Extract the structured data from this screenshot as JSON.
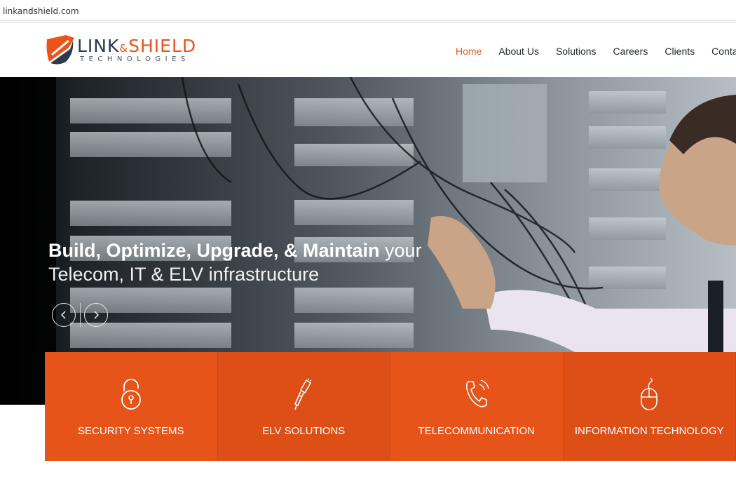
{
  "browser": {
    "url": "linkandshield.com"
  },
  "logo": {
    "word_link": "LINK",
    "word_amp": "&",
    "word_shield": "SHIELD",
    "tagline": "TECHNOLOGIES"
  },
  "nav": {
    "items": [
      {
        "label": "Home",
        "active": true
      },
      {
        "label": "About Us"
      },
      {
        "label": "Solutions"
      },
      {
        "label": "Careers"
      },
      {
        "label": "Clients"
      },
      {
        "label": "Contact"
      }
    ]
  },
  "hero": {
    "title_bold": "Build, Optimize, Upgrade, & Maintain",
    "title_light": " your",
    "subtitle": "Telecom, IT & ELV infrastructure"
  },
  "services": [
    {
      "label": "SECURITY SYSTEMS",
      "icon": "padlock-icon"
    },
    {
      "label": "ELV SOLUTIONS",
      "icon": "cable-plug-icon"
    },
    {
      "label": "TELECOMMUNICATION",
      "icon": "phone-icon"
    },
    {
      "label": "INFORMATION TECHNOLOGY",
      "icon": "mouse-icon"
    }
  ],
  "colors": {
    "accent": "#e8541a",
    "tile": "#e6541a",
    "dark_text": "#1d2530"
  }
}
